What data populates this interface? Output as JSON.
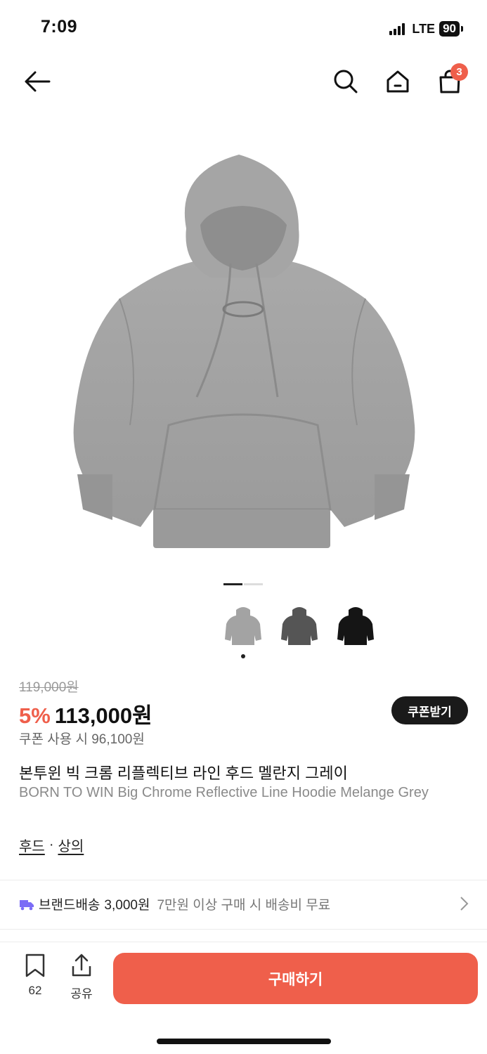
{
  "status": {
    "time": "7:09",
    "network": "LTE",
    "battery": "90"
  },
  "nav": {
    "cart_count": "3",
    "icons": [
      "back-arrow-icon",
      "search-icon",
      "home-icon",
      "shopping-bag-icon"
    ]
  },
  "gallery": {
    "pages": 2,
    "current_page": 1,
    "thumbnails": [
      "grey",
      "charcoal",
      "black"
    ],
    "selected_thumb": 0
  },
  "price": {
    "original": "119,000원",
    "discount": "5%",
    "sale": "113,000원",
    "coupon_text": "쿠폰 사용 시 96,100원",
    "coupon_button": "쿠폰받기"
  },
  "product": {
    "title_ko": "본투윈 빅 크롬 리플렉티브 라인 후드 멜란지 그레이",
    "title_en": "BORN TO WIN Big Chrome Reflective Line Hoodie Melange Grey",
    "categories": [
      "후드",
      "상의"
    ],
    "category_sep": "·"
  },
  "shipping": {
    "label": "브랜드배송",
    "fee": "3,000원",
    "note": "7만원 이상 구매 시 배송비 무료"
  },
  "bottom_bar": {
    "bookmark_count": "62",
    "share_label": "공유",
    "buy_label": "구매하기"
  },
  "colors": {
    "accent": "#ef5f4b",
    "hoodie_grey": "#a3a3a3",
    "hoodie_charcoal": "#555555",
    "hoodie_black": "#151515"
  }
}
